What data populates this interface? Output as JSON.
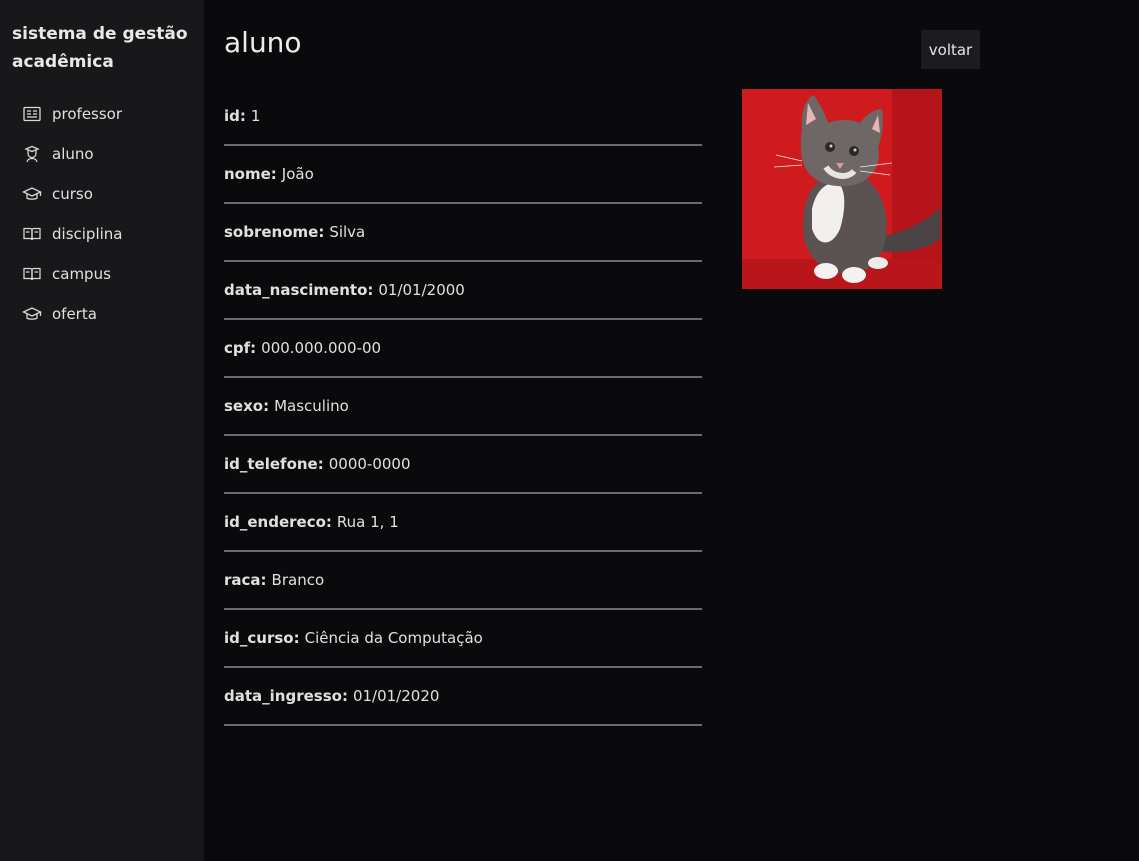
{
  "sidebar": {
    "title": "sistema de gestão acadêmica",
    "items": [
      {
        "label": "professor",
        "icon": "id-card-icon"
      },
      {
        "label": "aluno",
        "icon": "student-icon"
      },
      {
        "label": "curso",
        "icon": "graduation-cap-icon"
      },
      {
        "label": "disciplina",
        "icon": "book-icon"
      },
      {
        "label": "campus",
        "icon": "book-icon"
      },
      {
        "label": "oferta",
        "icon": "graduation-cap-icon"
      }
    ]
  },
  "header": {
    "title": "aluno",
    "back_label": "voltar"
  },
  "fields": [
    {
      "label": "id:",
      "value": "1"
    },
    {
      "label": "nome:",
      "value": "João"
    },
    {
      "label": "sobrenome:",
      "value": "Silva"
    },
    {
      "label": "data_nascimento:",
      "value": "01/01/2000"
    },
    {
      "label": "cpf:",
      "value": "000.000.000-00"
    },
    {
      "label": "sexo:",
      "value": "Masculino"
    },
    {
      "label": "id_telefone:",
      "value": "0000-0000"
    },
    {
      "label": "id_endereco:",
      "value": "Rua 1, 1"
    },
    {
      "label": "raca:",
      "value": "Branco"
    },
    {
      "label": "id_curso:",
      "value": "Ciência da Computação"
    },
    {
      "label": "data_ingresso:",
      "value": "01/01/2020"
    }
  ],
  "colors": {
    "background": "#0a0a0c",
    "sidebar": "#18181b",
    "divider": "#6b6b6e",
    "photo_background": "#d11a1c"
  }
}
